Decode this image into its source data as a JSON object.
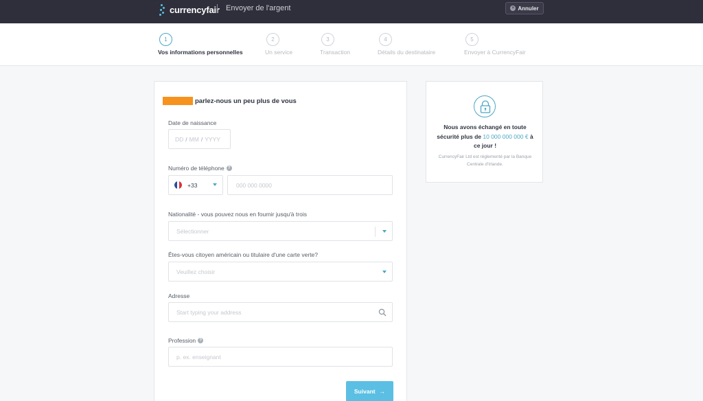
{
  "header": {
    "brand_name": "currencyfair",
    "subtitle": "Envoyer de l'argent",
    "cancel_label": "Annuler"
  },
  "steps": [
    {
      "number": "1",
      "label": "Vos informations personnelles",
      "active": true
    },
    {
      "number": "2",
      "label": "Un service",
      "active": false
    },
    {
      "number": "3",
      "label": "Transaction",
      "active": false
    },
    {
      "number": "4",
      "label": "Détails du destinataire",
      "active": false
    },
    {
      "number": "5",
      "label": "Envoyer à CurrencyFair",
      "active": false
    }
  ],
  "form": {
    "heading": "parlez-nous un peu plus de vous",
    "dob": {
      "label": "Date de naissance",
      "day_placeholder": "DD",
      "month_placeholder": "MM",
      "year_placeholder": "YYYY",
      "separator": "/"
    },
    "phone": {
      "label": "Numéro de téléphone",
      "country_code": "+33",
      "placeholder": "000 000 0000"
    },
    "nationality": {
      "label": "Nationalité - vous pouvez nous en fournir jusqu'à trois",
      "placeholder": "Sélectionner"
    },
    "us_citizen": {
      "label": "Êtes-vous citoyen américain ou titulaire d'une carte verte?",
      "placeholder": "Veuillez choisir"
    },
    "address": {
      "label": "Adresse",
      "placeholder": "Start typing your address"
    },
    "profession": {
      "label": "Profession",
      "placeholder": "p. ex. enseignant"
    },
    "next_label": "Suivant",
    "next_arrow": "→"
  },
  "info": {
    "title_prefix": "Nous avons échangé en toute sécurité plus de",
    "amount": "10 000 000 000 €",
    "title_suffix": "à ce jour !",
    "note": "CurrencyFair Ltd est réglementé par la Banque Centrale d'Irlande."
  },
  "colors": {
    "header_bg": "#2f2f3c",
    "accent": "#4aa7c4",
    "button": "#5bbfe3",
    "redaction": "#f7921e"
  },
  "icons": {
    "help": "?",
    "cancel": "×"
  }
}
